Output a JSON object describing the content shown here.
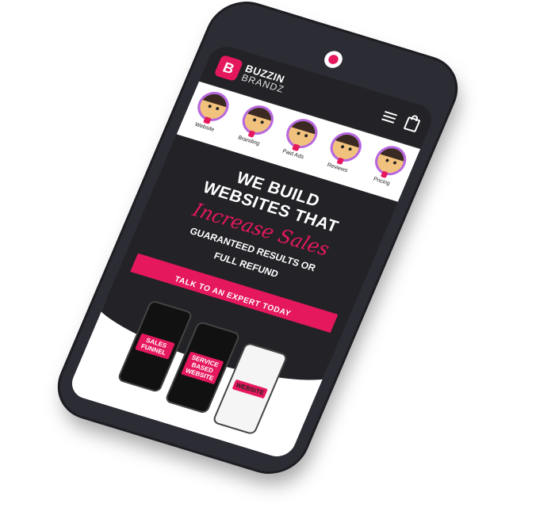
{
  "brand": {
    "line1": "BUZZIN",
    "line2": "BRANDZ",
    "mark": "B",
    "accent": "#e5185d"
  },
  "header": {
    "icons": [
      "menu-icon",
      "bag-icon"
    ]
  },
  "nav": {
    "items": [
      {
        "label": "Website"
      },
      {
        "label": "Branding"
      },
      {
        "label": "Paid Ads"
      },
      {
        "label": "Reviews"
      },
      {
        "label": "Pricing"
      }
    ]
  },
  "hero": {
    "title_line1": "WE BUILD",
    "title_line2": "WEBSITES THAT",
    "script": "Increase Sales",
    "sub_line1": "GUARANTEED RESULTS OR",
    "sub_line2": "FULL REFUND",
    "cta": "TALK TO AN EXPERT TODAY"
  },
  "showcase": {
    "phone1": "SALES FUNNEL",
    "phone2": "SERVICE BASED WEBSITE",
    "phone3": "WEBSITE"
  }
}
